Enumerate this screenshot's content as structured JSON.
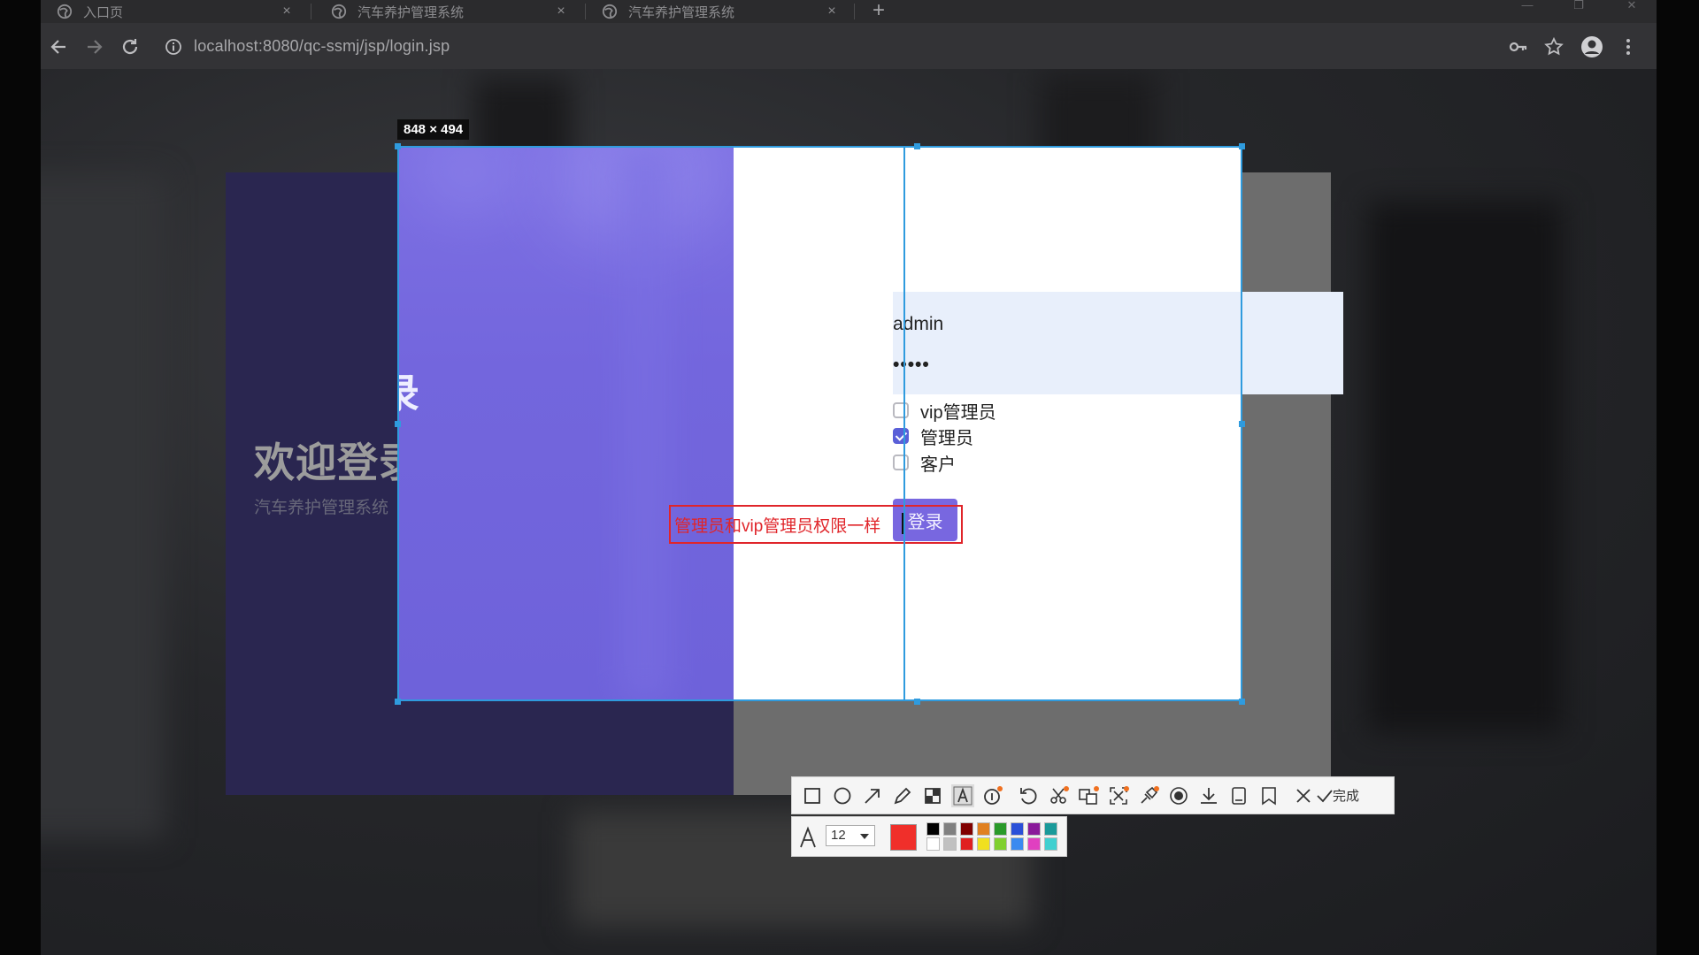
{
  "browser": {
    "tabs": [
      {
        "title": "入口页",
        "close": "×"
      },
      {
        "title": "汽车养护管理系统",
        "close": "×"
      },
      {
        "title": "汽车养护管理系统",
        "close": "×"
      }
    ],
    "new_tab": "+",
    "window_controls": {
      "minimize": "—",
      "restore": "❐",
      "close": "✕"
    },
    "url": "localhost:8080/qc-ssmj/jsp/login.jsp",
    "icons": [
      "back-icon",
      "forward-icon",
      "reload-icon",
      "info-icon",
      "key-icon",
      "star-icon",
      "account-icon",
      "menu-icon"
    ]
  },
  "login_page": {
    "welcome_title": "欢迎登录",
    "welcome_subtitle": "汽车养护管理系统",
    "username_value": "admin",
    "password_value": "•••••",
    "roles": [
      {
        "label": "vip管理员",
        "checked": false
      },
      {
        "label": "管理员",
        "checked": true
      },
      {
        "label": "客户",
        "checked": false
      }
    ],
    "login_button": "登录",
    "colors": {
      "accent": "#7867e0",
      "panel": "#7366dd",
      "input_bg": "#e8effb"
    }
  },
  "screenshot_tool": {
    "selection_size": "848 × 494",
    "annotation_text": "管理员和vip管理员权限一样",
    "annotation_color": "#e0252a",
    "done_label": "完成",
    "font_size_value": "12",
    "current_color": "#f02f2a",
    "palette_top": [
      "#000000",
      "#808080",
      "#800000",
      "#e08020",
      "#2a9a2a",
      "#2a50d8",
      "#8a1a9a",
      "#1a9a9a"
    ],
    "palette_bottom": [
      "#ffffff",
      "#c0c0c0",
      "#e02020",
      "#f0e020",
      "#80d030",
      "#3a8af0",
      "#e040c0",
      "#40d0d0"
    ],
    "tools": [
      "rectangle-icon",
      "ellipse-icon",
      "arrow-icon",
      "pencil-icon",
      "mosaic-icon",
      "text-icon",
      "number-icon",
      "undo-icon",
      "clip-icon",
      "translate-icon",
      "ocr-icon",
      "pin-icon",
      "record-icon",
      "download-icon",
      "long-screenshot-icon",
      "bookmark-icon",
      "cancel-icon",
      "done-check-icon"
    ]
  }
}
